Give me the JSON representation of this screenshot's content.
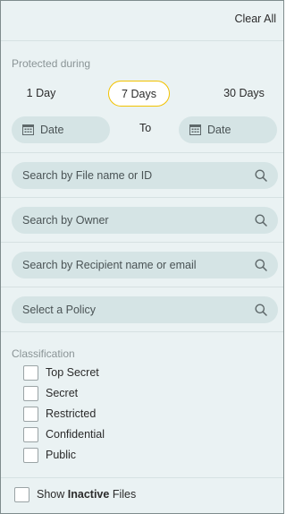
{
  "header": {
    "clear_all_label": "Clear All"
  },
  "protected": {
    "label": "Protected during",
    "ranges": [
      "1 Day",
      "7 Days",
      "30 Days"
    ],
    "active_range": "7 Days",
    "from_placeholder": "Date",
    "to_label": "To",
    "to_placeholder": "Date"
  },
  "searches": {
    "file": "Search by File name or ID",
    "owner": "Search by Owner",
    "recipient": "Search by Recipient name or email",
    "policy": "Select a Policy"
  },
  "classification": {
    "label": "Classification",
    "options": [
      "Top Secret",
      "Secret",
      "Restricted",
      "Confidential",
      "Public"
    ]
  },
  "inactive": {
    "prefix": "Show",
    "bold": "Inactive",
    "suffix": "Files"
  },
  "colors": {
    "accent": "#f2c200",
    "field_bg": "#d5e4e5",
    "panel_bg": "#eaf2f3"
  }
}
